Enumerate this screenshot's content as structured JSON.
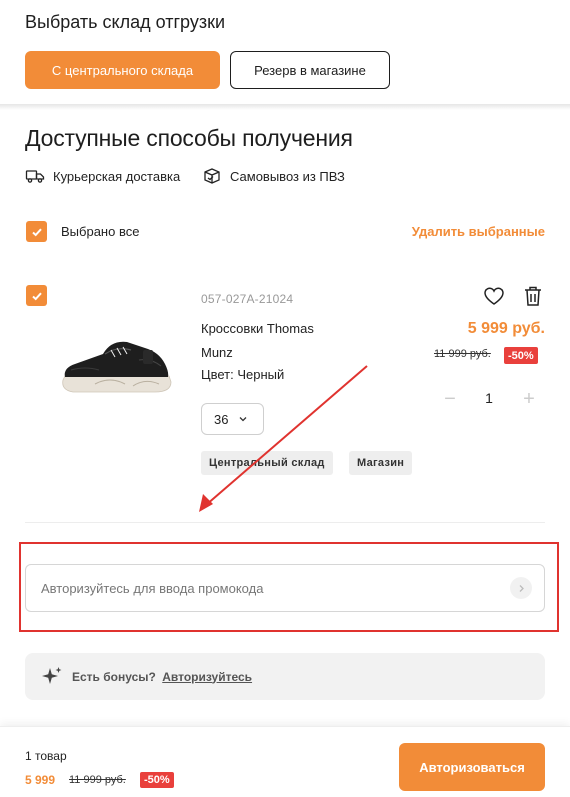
{
  "warehouse": {
    "title": "Выбрать склад отгрузки",
    "central_label": "С центрального склада",
    "reserve_label": "Резерв в магазине"
  },
  "delivery": {
    "title": "Доступные способы получения",
    "methods": [
      {
        "label": "Курьерская доставка",
        "icon": "truck-icon"
      },
      {
        "label": "Самовывоз из ПВЗ",
        "icon": "pickup-box-icon"
      }
    ]
  },
  "cart": {
    "select_all_label": "Выбрано все",
    "delete_selected_label": "Удалить выбранные",
    "item": {
      "sku": "057-027A-21024",
      "name_line1": "Кроссовки Thomas",
      "name_line2": "Munz",
      "color": "Цвет: Черный",
      "size": "36",
      "tags": [
        "Центральный склад",
        "Магазин"
      ],
      "price": "5 999 руб.",
      "old_price": "11 999 руб.",
      "discount": "-50%",
      "quantity": "1",
      "minus": "−",
      "plus": "+"
    }
  },
  "promo": {
    "placeholder": "Авторизуйтесь для ввода промокода"
  },
  "bonus": {
    "question": "Есть бонусы?",
    "link": "Авторизуйтесь"
  },
  "footer": {
    "count": "1 товар",
    "price": "5 999",
    "old_price": "11 999 руб.",
    "discount": "-50%",
    "auth_label": "Авторизоваться"
  },
  "colors": {
    "accent": "#f28c38",
    "discount": "#e9403c",
    "annotation": "#e0332f"
  }
}
